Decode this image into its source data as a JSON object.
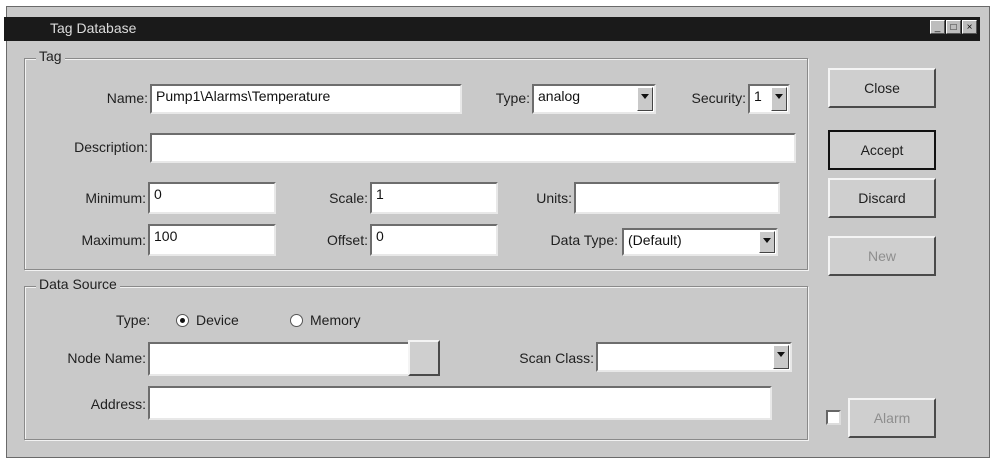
{
  "window": {
    "title": "Tag Database",
    "controls": [
      "minimize-icon",
      "maximize-icon",
      "close-icon"
    ]
  },
  "tag": {
    "legend": "Tag",
    "name_label": "Name:",
    "name_value": "Pump1\\Alarms\\Temperature",
    "type_label": "Type:",
    "type_value": "analog",
    "security_label": "Security:",
    "security_value": "1",
    "description_label": "Description:",
    "description_value": "",
    "minimum_label": "Minimum:",
    "minimum_value": "0",
    "maximum_label": "Maximum:",
    "maximum_value": "100",
    "scale_label": "Scale:",
    "scale_value": "1",
    "offset_label": "Offset:",
    "offset_value": "0",
    "units_label": "Units:",
    "units_value": "",
    "data_type_label": "Data Type:",
    "data_type_value": "(Default)"
  },
  "data_source": {
    "legend": "Data Source",
    "type_label": "Type:",
    "device_label": "Device",
    "memory_label": "Memory",
    "selected": "Device",
    "node_name_label": "Node Name:",
    "node_name_value": "",
    "scan_class_label": "Scan Class:",
    "scan_class_value": "",
    "address_label": "Address:",
    "address_value": ""
  },
  "buttons": {
    "close": "Close",
    "accept": "Accept",
    "discard": "Discard",
    "new": "New",
    "alarm": "Alarm"
  },
  "alarm_checked": false
}
